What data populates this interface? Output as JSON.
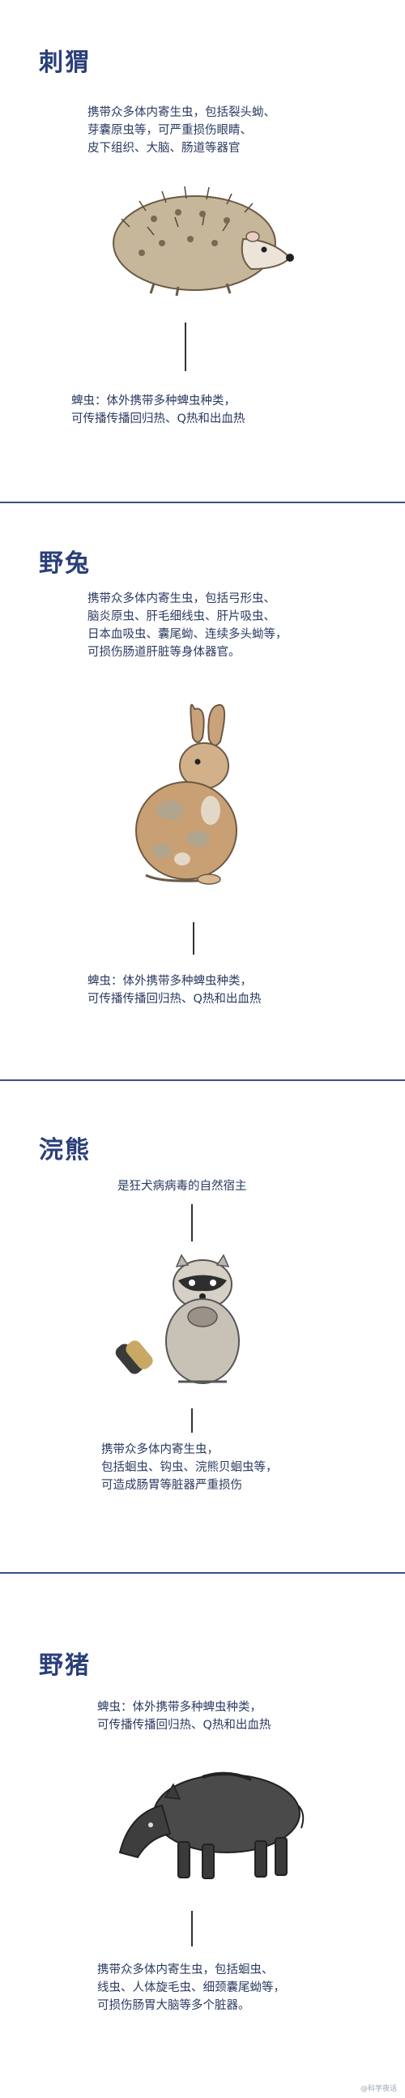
{
  "sections": [
    {
      "title": "刺猬",
      "note_top": "携带众多体内寄生虫，包括裂头蚴、\n芽囊原虫等，可严重损伤眼睛、\n皮下组织、大脑、肠道等器官",
      "note_bottom": "蜱虫：体外携带多种蜱虫种类，\n可传播传播回归热、Q热和出血热"
    },
    {
      "title": "野兔",
      "note_top": "携带众多体内寄生虫，包括弓形虫、\n脑炎原虫、肝毛细线虫、肝片吸虫、\n日本血吸虫、囊尾蚴、连续多头蚴等，\n可损伤肠道肝脏等身体器官。",
      "note_bottom": "蜱虫：体外携带多种蜱虫种类，\n可传播传播回归热、Q热和出血热"
    },
    {
      "title": "浣熊",
      "note_top": "是狂犬病病毒的自然宿主",
      "note_bottom": "携带众多体内寄生虫，\n包括蛔虫、钩虫、浣熊贝蛔虫等，\n可造成肠胃等脏器严重损伤"
    },
    {
      "title": "野猪",
      "note_top": "蜱虫：体外携带多种蜱虫种类，\n可传播传播回归热、Q热和出血热",
      "note_bottom": "携带众多体内寄生虫，包括蛔虫、\n线虫、人体旋毛虫、细颈囊尾蚴等，\n可损伤肠胃大脑等多个脏器。"
    }
  ],
  "watermark": "@科学夜话",
  "colors": {
    "title": "#2a3f7a",
    "text": "#2c3b62",
    "divider": "#3a4f86"
  }
}
